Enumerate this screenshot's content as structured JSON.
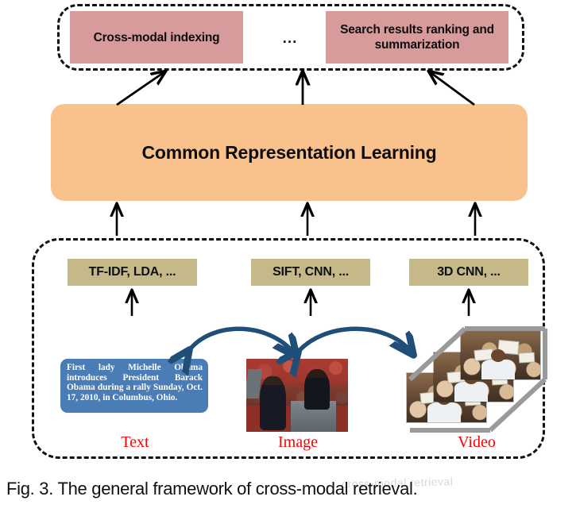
{
  "figure": {
    "caption": "Fig. 3.  The general framework of cross-modal retrieval.",
    "watermark": "cross-modal retrieval"
  },
  "application_layer": {
    "name": "application-layer",
    "boxes": [
      {
        "label": "Cross-modal indexing"
      },
      {
        "label": "Search results ranking and summarization"
      }
    ],
    "separator": "..."
  },
  "common_layer": {
    "label": "Common Representation Learning"
  },
  "feature_layer": {
    "boxes": [
      {
        "label": "TF-IDF, LDA, ..."
      },
      {
        "label": "SIFT, CNN, ..."
      },
      {
        "label": "3D CNN, ..."
      }
    ]
  },
  "media_layer": {
    "text_sample": "First lady Michelle Obama introduces President Barack Obama during a rally Sunday, Oct. 17, 2010, in Columbus, Ohio.",
    "modalities": [
      {
        "label": "Text"
      },
      {
        "label": "Image"
      },
      {
        "label": "Video"
      }
    ]
  },
  "colors": {
    "application_box": "#d79b9b",
    "common_box": "#f9c28d",
    "feature_box": "#c5b98a",
    "text_sample_box": "#4a7cb5",
    "modality_label": "#fa0005",
    "arrow": "#000000",
    "curved_arrow": "#1f4e79",
    "video_wire": "#9a9a9a",
    "dashed_border": "#111111"
  }
}
